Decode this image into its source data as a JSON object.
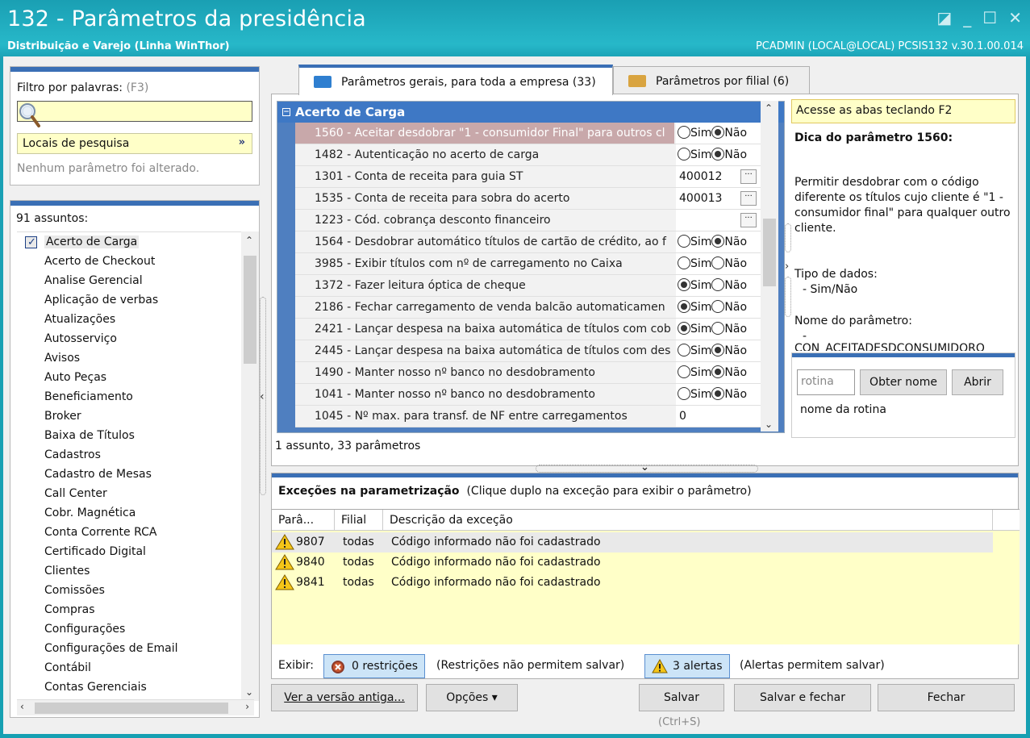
{
  "window": {
    "title": "132 - Parâmetros da presidência",
    "subtitle": "Distribuição e Varejo (Linha WinThor)",
    "userinfo": "PCADMIN (LOCAL@LOCAL)   PCSIS132  v.30.1.00.014",
    "controls": [
      "◪",
      "_",
      "☐",
      "✕"
    ]
  },
  "filter": {
    "label": "Filtro por palavras:",
    "shortcut": "(F3)",
    "search_value": "",
    "locais_label": "Locais de pesquisa",
    "status": "Nenhum parâmetro foi alterado."
  },
  "subjects": {
    "count_label": "91 assuntos:",
    "items": [
      "Acerto de Carga",
      "Acerto de Checkout",
      "Analise Gerencial",
      "Aplicação de verbas",
      "Atualizações",
      "Autosserviço",
      "Avisos",
      "Auto Peças",
      "Beneficiamento",
      "Broker",
      "Baixa de Títulos",
      "Cadastros",
      "Cadastro de Mesas",
      "Call Center",
      "Cobr. Magnética",
      "Conta Corrente RCA",
      "Certificado Digital",
      "Clientes",
      "Comissões",
      "Compras",
      "Configurações",
      "Configurações de Email",
      "Contábil",
      "Contas Gerenciais"
    ]
  },
  "tabs": [
    {
      "label": "Parâmetros gerais, para toda a empresa  (33)",
      "color": "#2f7fd0"
    },
    {
      "label": "Parâmetros por filial  (6)",
      "color": "#d9a440"
    }
  ],
  "grid": {
    "group": "Acerto de Carga",
    "rows": [
      {
        "name": "1560 - Aceitar desdobrar \"1 - consumidor Final\" para outros cl",
        "type": "bool",
        "value": "nao",
        "highlight": true
      },
      {
        "name": "1482 - Autenticação no acerto de carga",
        "type": "bool",
        "value": "nao"
      },
      {
        "name": "1301 - Conta de receita para guia ST",
        "type": "text",
        "value": "400012",
        "ellipsis": true
      },
      {
        "name": "1535 - Conta de receita para sobra do acerto",
        "type": "text",
        "value": "400013",
        "ellipsis": true
      },
      {
        "name": "1223 - Cód. cobrança desconto financeiro",
        "type": "text",
        "value": "",
        "ellipsis": true
      },
      {
        "name": "1564 - Desdobrar automático títulos de cartão de crédito, ao f",
        "type": "bool",
        "value": "nao"
      },
      {
        "name": "3985 - Exibir títulos com nº de carregamento no Caixa",
        "type": "bool",
        "value": "none"
      },
      {
        "name": "1372 - Fazer leitura óptica de cheque",
        "type": "bool",
        "value": "sim"
      },
      {
        "name": "2186 - Fechar carregamento de venda balcão automaticamen",
        "type": "bool",
        "value": "sim"
      },
      {
        "name": "2421 - Lançar despesa na baixa automática de títulos com cob",
        "type": "bool",
        "value": "sim"
      },
      {
        "name": "2445 - Lançar despesa na baixa automática de títulos com des",
        "type": "bool",
        "value": "nao"
      },
      {
        "name": "1490 - Manter nosso nº banco no desdobramento",
        "type": "bool",
        "value": "nao"
      },
      {
        "name": "1041 - Manter nosso nº banco no desdobramento",
        "type": "bool",
        "value": "nao"
      },
      {
        "name": "1045 - Nº max. para transf. de NF entre carregamentos",
        "type": "text",
        "value": "0"
      }
    ],
    "sim_label": "Sim",
    "nao_label": "Não",
    "status": "1 assunto, 33 parâmetros"
  },
  "tip": {
    "hint": "Acesse as abas teclando F2",
    "title": "Dica do parâmetro 1560:",
    "text": "Permitir desdobrar com o código diferente os títulos cujo cliente é \"1 - consumidor final\" para qualquer outro cliente.",
    "type_label": "Tipo de dados:",
    "type_value": "- Sim/Não",
    "name_label": "Nome do parâmetro:",
    "name_value": "-",
    "name_cut": "CON_ACEITADESDCONSUMIDORO"
  },
  "rotina": {
    "placeholder": "rotina",
    "obter_label": "Obter nome",
    "abrir_label": "Abrir",
    "name_label": "nome da rotina"
  },
  "exceptions": {
    "title": "Exceções na parametrização",
    "hint": "(Clique duplo na exceção para exibir o parâmetro)",
    "columns": [
      "Parâ...",
      "Filial",
      "Descrição da exceção"
    ],
    "rows": [
      {
        "param": "9807",
        "filial": "todas",
        "desc": "Código informado não foi cadastrado"
      },
      {
        "param": "9840",
        "filial": "todas",
        "desc": "Código informado não foi cadastrado"
      },
      {
        "param": "9841",
        "filial": "todas",
        "desc": "Código informado não foi cadastrado"
      }
    ],
    "exibir_label": "Exibir:",
    "restricoes_label": "0 restrições",
    "restricoes_note": "(Restrições não permitem salvar)",
    "alertas_label": "3 alertas",
    "alertas_note": "(Alertas permitem salvar)"
  },
  "buttons": {
    "versao": "Ver a versão antiga...",
    "opcoes": "Opções ▾",
    "salvar": "Salvar",
    "salvar_shortcut": "(Ctrl+S)",
    "salvar_fechar": "Salvar e fechar",
    "fechar": "Fechar"
  }
}
